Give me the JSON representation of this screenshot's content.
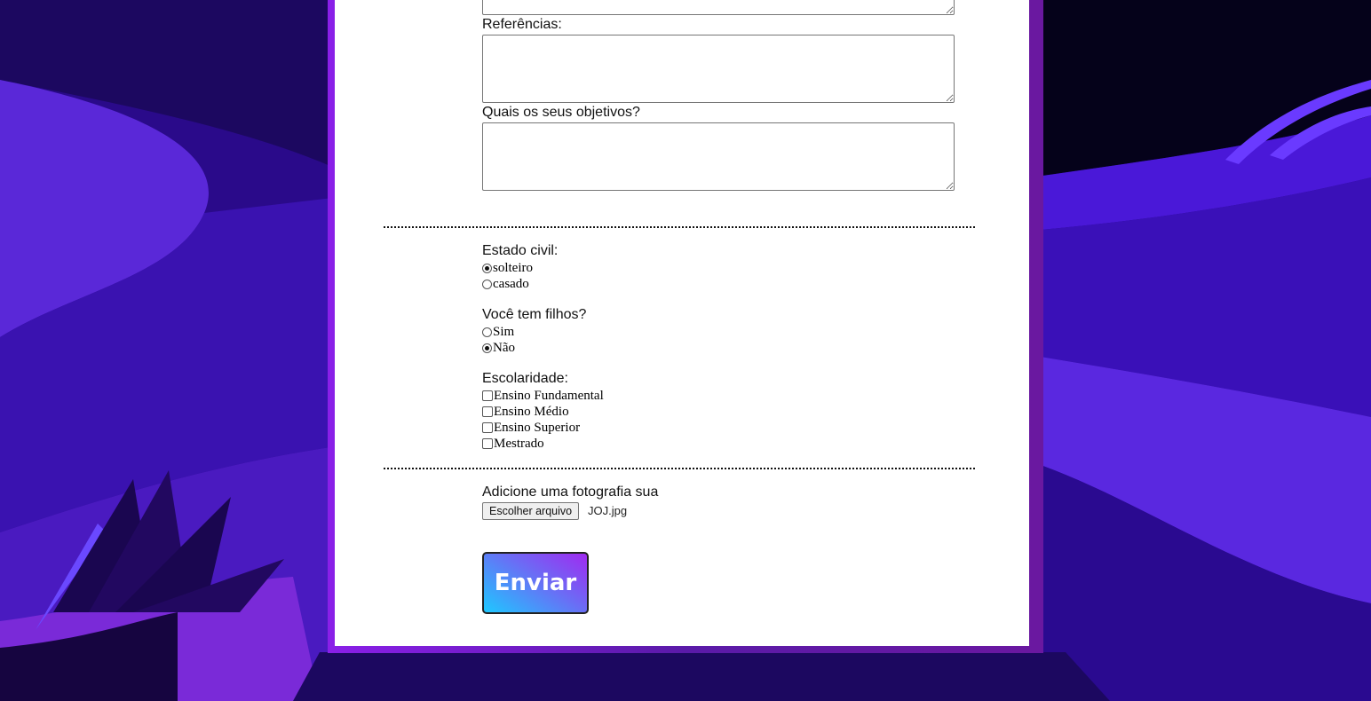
{
  "form": {
    "references_label": "Referências:",
    "objectives_label": "Quais os seus objetivos?",
    "marital_label": "Estado civil:",
    "marital_options": [
      {
        "label": "solteiro",
        "checked": true
      },
      {
        "label": "casado",
        "checked": false
      }
    ],
    "children_label": "Você tem filhos?",
    "children_options": [
      {
        "label": "Sim",
        "checked": false
      },
      {
        "label": "Não",
        "checked": true
      }
    ],
    "education_label": "Escolaridade:",
    "education_options": [
      {
        "label": "Ensino Fundamental",
        "checked": false
      },
      {
        "label": "Ensino Médio",
        "checked": false
      },
      {
        "label": "Ensino Superior",
        "checked": false
      },
      {
        "label": "Mestrado",
        "checked": false
      }
    ],
    "photo_label": "Adicione uma fotografia sua",
    "file_button_label": "Escolher arquivo",
    "file_name": "JOJ.jpg",
    "submit_label": "Enviar"
  },
  "colors": {
    "card_border_left": "#8a1fe8",
    "card_border_right": "#6a18a0",
    "submit_gradient_start": "#1ec8ff",
    "submit_gradient_end": "#a02af0"
  }
}
